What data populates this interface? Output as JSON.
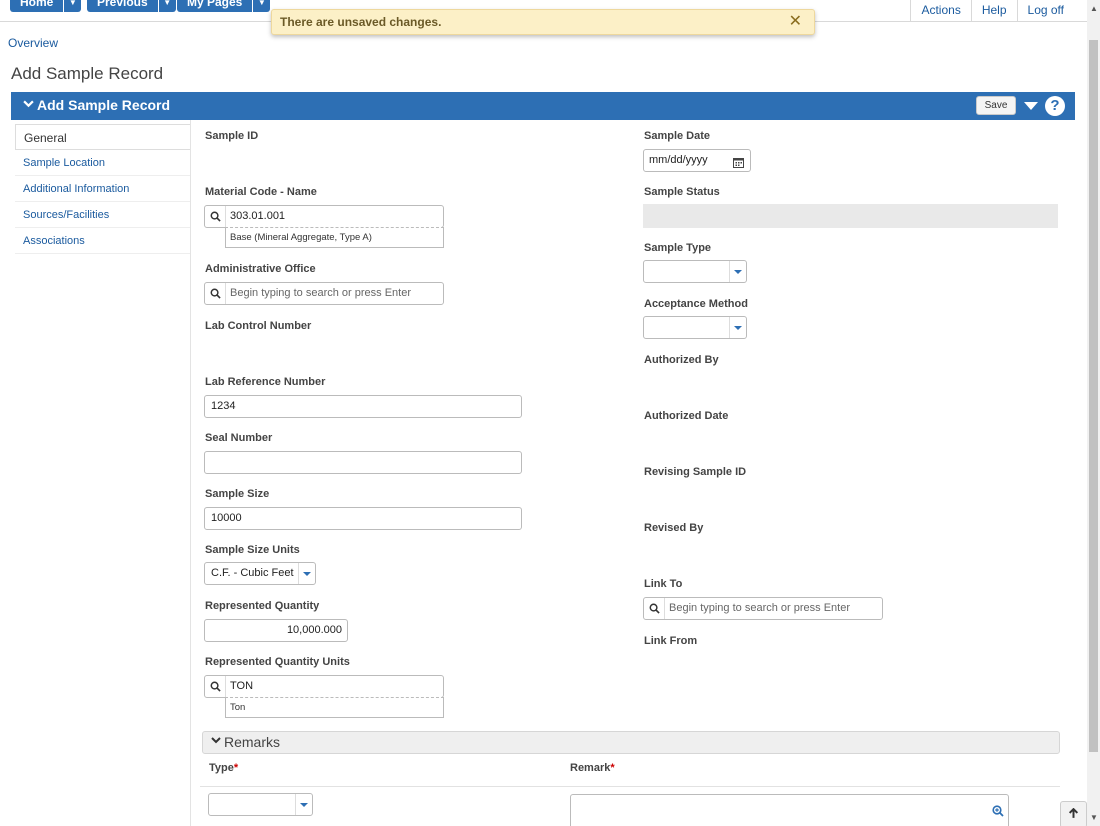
{
  "nav": {
    "home_label": "Home",
    "previous_label": "Previous",
    "mypages_label": "My Pages",
    "links": [
      "Actions",
      "Help",
      "Log off"
    ]
  },
  "toast": {
    "message": "There are unsaved changes.",
    "close_glyph": "✕"
  },
  "breadcrumb": "Overview",
  "page_title": "Add Sample Record",
  "panel": {
    "title": "Add Sample Record",
    "save_label": "Save",
    "help_glyph": "?"
  },
  "sidebar": {
    "items": [
      {
        "label": "General"
      },
      {
        "label": "Sample Location"
      },
      {
        "label": "Additional Information"
      },
      {
        "label": "Sources/Facilities"
      },
      {
        "label": "Associations"
      }
    ]
  },
  "form": {
    "sample_id": {
      "label": "Sample ID"
    },
    "material_code": {
      "label": "Material Code - Name",
      "value": "303.01.001",
      "description": "Base (Mineral Aggregate, Type A)"
    },
    "admin_office": {
      "label": "Administrative Office",
      "placeholder": "Begin typing to search or press Enter"
    },
    "lab_control": {
      "label": "Lab Control Number"
    },
    "lab_reference": {
      "label": "Lab Reference Number",
      "value": "1234"
    },
    "seal_number": {
      "label": "Seal Number",
      "value": ""
    },
    "sample_size": {
      "label": "Sample Size",
      "value": "10000"
    },
    "sample_size_units": {
      "label": "Sample Size Units",
      "value": "C.F. - Cubic Feet"
    },
    "represented_qty": {
      "label": "Represented Quantity",
      "value": "10,000.000"
    },
    "represented_qty_units": {
      "label": "Represented Quantity Units",
      "value": "TON",
      "description": "Ton"
    },
    "sample_date": {
      "label": "Sample Date",
      "placeholder": "mm/dd/yyyy"
    },
    "sample_status": {
      "label": "Sample Status"
    },
    "sample_type": {
      "label": "Sample Type"
    },
    "acceptance_method": {
      "label": "Acceptance Method"
    },
    "authorized_by": {
      "label": "Authorized By"
    },
    "authorized_date": {
      "label": "Authorized Date"
    },
    "revising_sample_id": {
      "label": "Revising Sample ID"
    },
    "revised_by": {
      "label": "Revised By"
    },
    "link_to": {
      "label": "Link To",
      "placeholder": "Begin typing to search or press Enter"
    },
    "link_from": {
      "label": "Link From"
    }
  },
  "remarks": {
    "title": "Remarks",
    "type_header": "Type",
    "remark_header": "Remark",
    "required_mark": "*"
  },
  "colors": {
    "accent": "#2d6fb4",
    "toast_bg": "#fcf0c7",
    "link": "#1a5a9e"
  }
}
